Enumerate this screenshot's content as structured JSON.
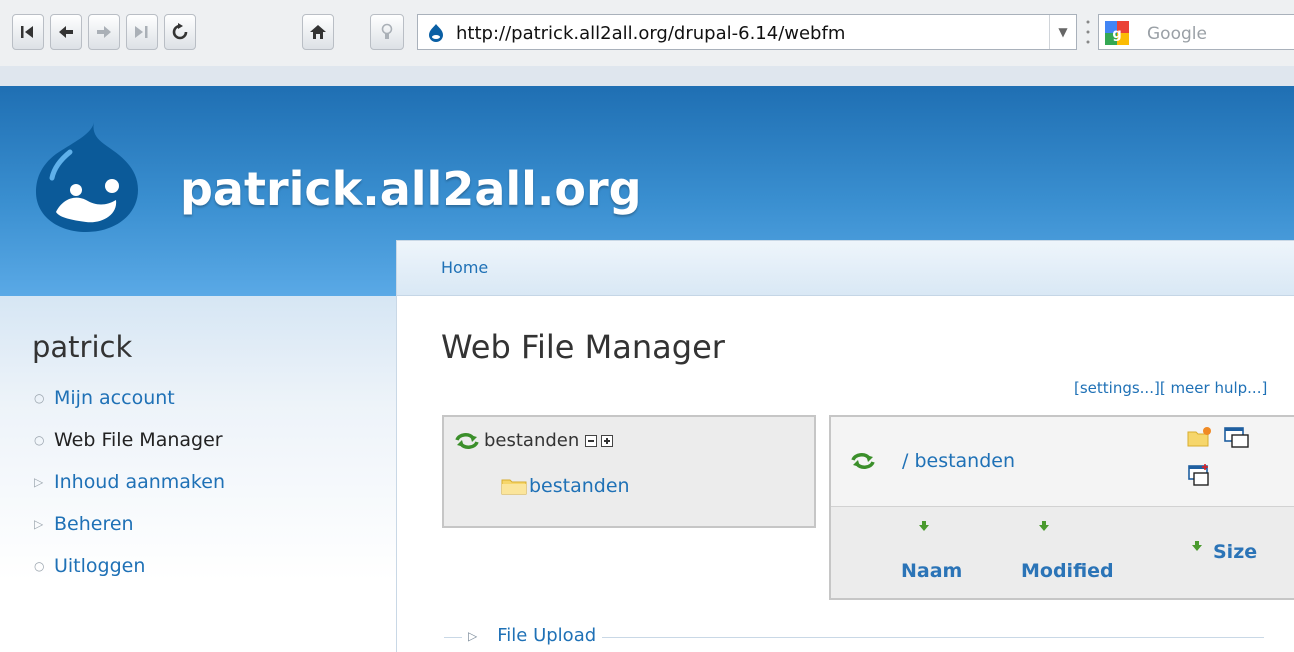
{
  "browser": {
    "url": "http://patrick.all2all.org/drupal-6.14/webfm",
    "search_placeholder": "Google"
  },
  "site": {
    "name": "patrick.all2all.org"
  },
  "breadcrumb": {
    "home": "Home"
  },
  "sidebar": {
    "title": "patrick",
    "items": [
      {
        "label": "Mijn account"
      },
      {
        "label": "Web File Manager"
      },
      {
        "label": "Inhoud aanmaken"
      },
      {
        "label": "Beheren"
      },
      {
        "label": "Uitloggen"
      }
    ]
  },
  "main": {
    "title": "Web File Manager",
    "settings_link": "[settings...]",
    "help_link": "[ meer hulp...]",
    "tree": {
      "root": "bestanden",
      "child": "bestanden"
    },
    "files": {
      "path": "/ bestanden",
      "columns": {
        "name": "Naam",
        "modified": "Modified",
        "size": "Size"
      }
    },
    "upload_legend": "File Upload"
  }
}
